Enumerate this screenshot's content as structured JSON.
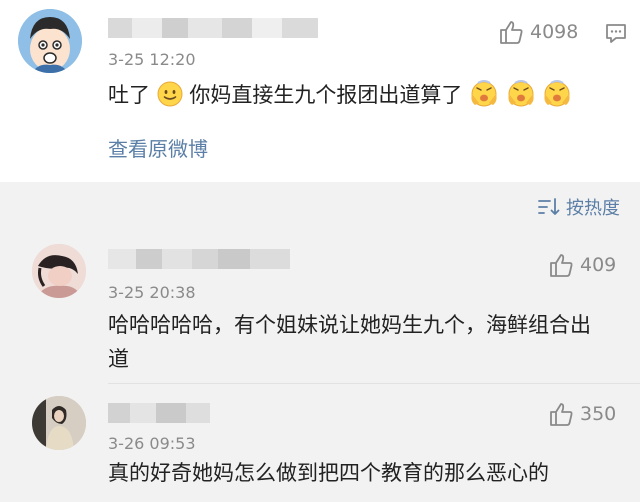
{
  "main_comment": {
    "time": "3-25 12:20",
    "likes": "4098",
    "text_parts": [
      "吐了",
      "你妈直接生九个报团出道算了"
    ],
    "view_original": "查看原微博"
  },
  "sort": {
    "label": "按热度"
  },
  "replies": [
    {
      "time": "3-25 20:38",
      "likes": "409",
      "text": "哈哈哈哈哈，有个姐妹说让她妈生九个，海鲜组合出道"
    },
    {
      "time": "3-26 09:53",
      "likes": "350",
      "text": "真的好奇她妈怎么做到把四个教育的那么恶心的"
    }
  ],
  "colors": {
    "link": "#5b7fa6",
    "panel_bg": "#f2f2f2"
  }
}
